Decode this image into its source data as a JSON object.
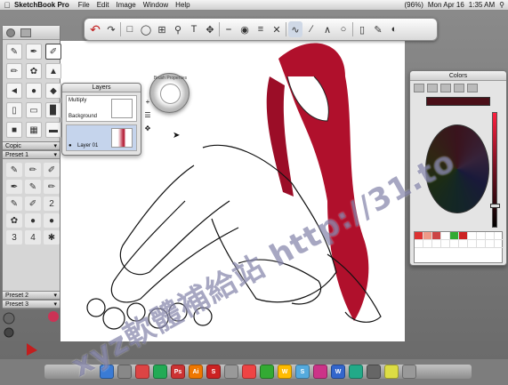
{
  "menubar": {
    "app": "SketchBook Pro",
    "menus": [
      "File",
      "Edit",
      "Image",
      "Window",
      "Help"
    ],
    "status": [
      "(96%)",
      "Mon Apr 16",
      "1:35 AM"
    ]
  },
  "toolbar": {
    "tools": [
      "undo-arrow",
      "redo-arrow",
      "rect-select",
      "lasso",
      "crop",
      "zoom",
      "text",
      "move",
      "ruler",
      "ellipse",
      "symmetry",
      "transform",
      "pen",
      "line",
      "polyline",
      "ellipse-shape",
      "eraser",
      "brush-puck",
      "color-wheel"
    ]
  },
  "left_panel": {
    "copic_label": "Copic",
    "preset1_label": "Preset 1",
    "preset2_label": "Preset 2",
    "preset3_label": "Preset 3",
    "preset_numbers": [
      "2",
      "3",
      "4"
    ]
  },
  "layers_panel": {
    "title": "Layers",
    "blend": "Multiply",
    "layer_names": [
      "Background",
      "Layer 01"
    ]
  },
  "brush_props": {
    "label": "Brush Properties"
  },
  "colors_panel": {
    "title": "Colors",
    "current_color": "#4a0f18"
  },
  "watermark": "xyz軟體補給站 http://31.to",
  "colors": {
    "hair": "#b0102c",
    "accent": "#c21e1e"
  }
}
